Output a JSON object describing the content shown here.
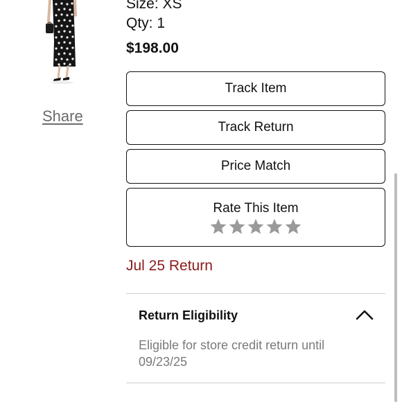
{
  "product": {
    "size": "Size: XS",
    "qty": "Qty: 1",
    "price": "$198.00",
    "share_label": "Share"
  },
  "actions": {
    "track_item": "Track Item",
    "track_return": "Track Return",
    "price_match": "Price Match"
  },
  "rating": {
    "title": "Rate This Item",
    "max_stars": 5,
    "current_rating": 0,
    "star_color": "#9a9a9a"
  },
  "return_info": {
    "date_label": "Jul 25 Return",
    "date_color": "#8b1a1a"
  },
  "accordion": {
    "title": "Return Eligibility",
    "expanded": true,
    "body": "Eligible for store credit return until 09/23/25",
    "icon": "chevron-up-icon"
  }
}
